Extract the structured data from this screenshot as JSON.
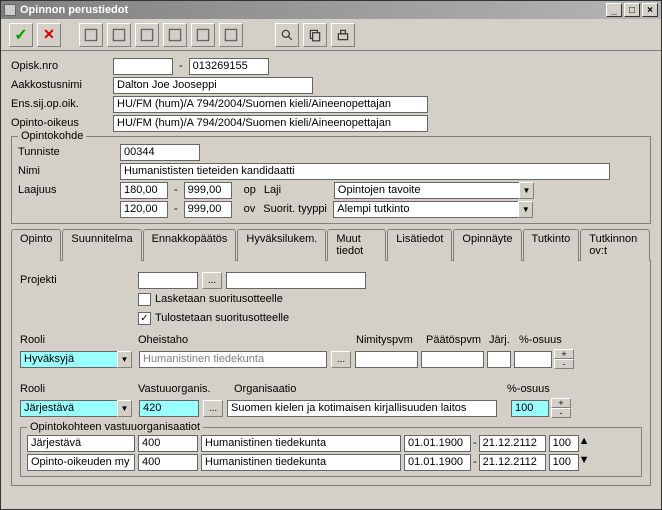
{
  "window": {
    "title": "Opinnon perustiedot"
  },
  "labels": {
    "opisk": "Opisk.nro",
    "aakk": "Aakkostusnimi",
    "ens": "Ens.sij.op.oik.",
    "opoik": "Opinto-oikeus",
    "tunniste": "Tunniste",
    "nimi": "Nimi",
    "laajuus": "Laajuus",
    "laji": "Laji",
    "styyppi": "Suorit. tyyppi",
    "op": "op",
    "ov": "ov",
    "projekti": "Projekti",
    "lask": "Lasketaan suoritusotteelle",
    "tulos": "Tulostetaan suoritusotteelle",
    "rooli": "Rooli",
    "oheistaho": "Oheistaho",
    "nimityspvm": "Nimityspvm",
    "paatospvm": "Päätöspvm",
    "jarj": "Järj.",
    "osuus": "%-osuus",
    "vastuuorg": "Vastuuorganis.",
    "organisaatio": "Organisaatio"
  },
  "fields": {
    "opisk1": "",
    "opisk2": "013269155",
    "aakk": "Dalton Joe Jooseppi",
    "ens": "HU/FM (hum)/A 794/2004/Suomen kieli/Aineenopettajan",
    "opoik": "HU/FM (hum)/A 794/2004/Suomen kieli/Aineenopettajan"
  },
  "opintokohde": {
    "legend": "Opintokohde",
    "tunniste": "00344",
    "nimi": "Humanististen tieteiden kandidaatti",
    "l1a": "180,00",
    "l1b": "999,00",
    "l2a": "120,00",
    "l2b": "999,00",
    "laji": "Opintojen tavoite",
    "styyppi": "Alempi tutkinto"
  },
  "tabs": [
    "Opinto",
    "Suunnitelma",
    "Ennakkopäätös",
    "Hyväksilukem.",
    "Muut tiedot",
    "Lisätiedot",
    "Opinnäyte",
    "Tutkinto",
    "Tutkinnon ov:t"
  ],
  "muut": {
    "projekti": "",
    "rooli1": "Hyväksyjä",
    "oheistaho": "Humanistinen tiedekunta",
    "rooli2": "Järjestävä",
    "vastuu_code": "420",
    "vastuu_name": "Suomen kielen ja kotimaisen kirjallisuuden laitos",
    "osuus2": "100"
  },
  "vastuu": {
    "legend": "Opintokohteen vastuuorganisaatiot",
    "rows": [
      {
        "r": "Järjestävä",
        "code": "400",
        "name": "Humanistinen tiedekunta",
        "d1": "01.01.1900",
        "d2": "21.12.2112",
        "p": "100"
      },
      {
        "r": "Opinto-oikeuden my",
        "code": "400",
        "name": "Humanistinen tiedekunta",
        "d1": "01.01.1900",
        "d2": "21.12.2112",
        "p": "100"
      }
    ]
  }
}
